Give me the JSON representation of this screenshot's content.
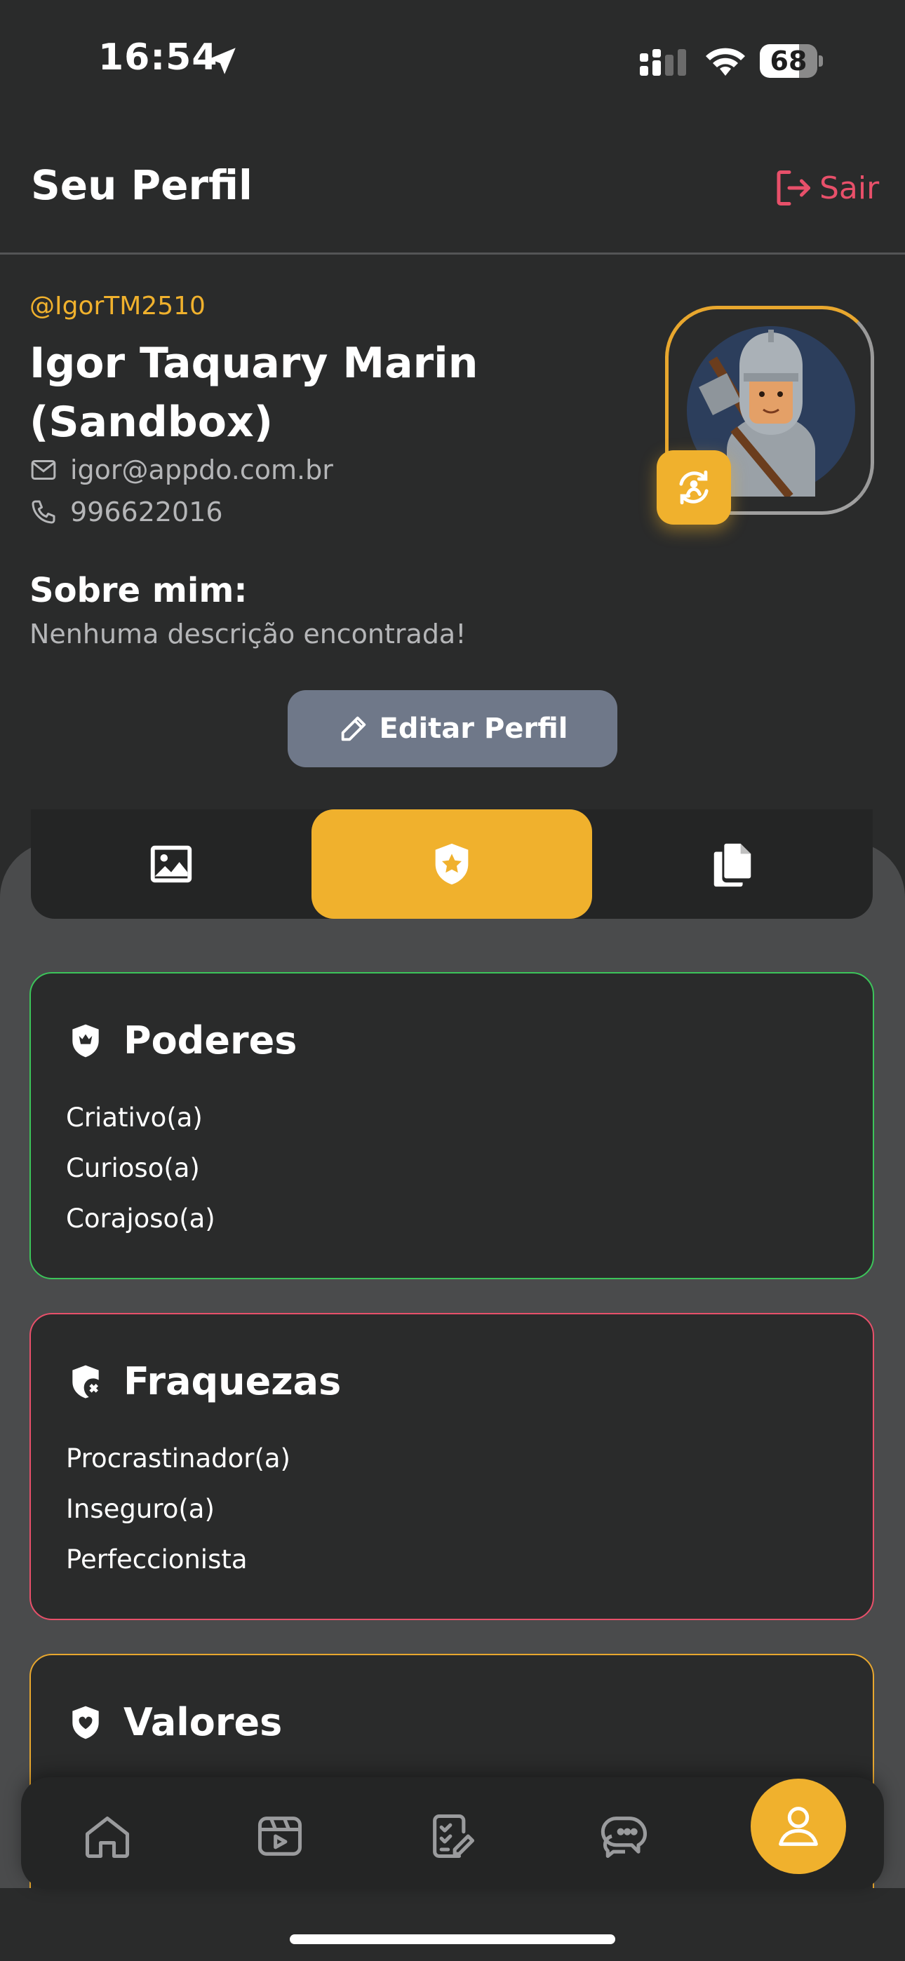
{
  "status_bar": {
    "time": "16:54",
    "battery": "68",
    "battery_level": 0.68
  },
  "header": {
    "title": "Seu Perfil",
    "logout_label": "Sair"
  },
  "profile": {
    "username": "@IgorTM2510",
    "full_name": "Igor Taquary Marin (Sandbox)",
    "email": "igor@appdo.com.br",
    "phone": "996622016",
    "about_title": "Sobre mim:",
    "about_text": "Nenhuma descrição encontrada!",
    "edit_label": "Editar Perfil"
  },
  "tabs": [
    {
      "icon": "image-icon",
      "active": false
    },
    {
      "icon": "shield-star-icon",
      "active": true
    },
    {
      "icon": "documents-icon",
      "active": false
    }
  ],
  "cards": {
    "powers": {
      "title": "Poderes",
      "items": [
        "Criativo(a)",
        "Curioso(a)",
        "Corajoso(a)"
      ],
      "color": "#3cc45a"
    },
    "weaknesses": {
      "title": "Fraquezas",
      "items": [
        "Procrastinador(a)",
        "Inseguro(a)",
        "Perfeccionista"
      ],
      "color": "#e8506a"
    },
    "values": {
      "title": "Valores",
      "color": "#e8a72e"
    }
  },
  "bottom_nav": [
    {
      "icon": "home-icon"
    },
    {
      "icon": "video-icon"
    },
    {
      "icon": "tasks-icon"
    },
    {
      "icon": "chat-icon"
    },
    {
      "icon": "user-icon",
      "active": true
    }
  ],
  "colors": {
    "accent": "#f0b12d",
    "danger": "#e8506a",
    "success": "#3cc45a",
    "background": "#2a2b2b"
  }
}
